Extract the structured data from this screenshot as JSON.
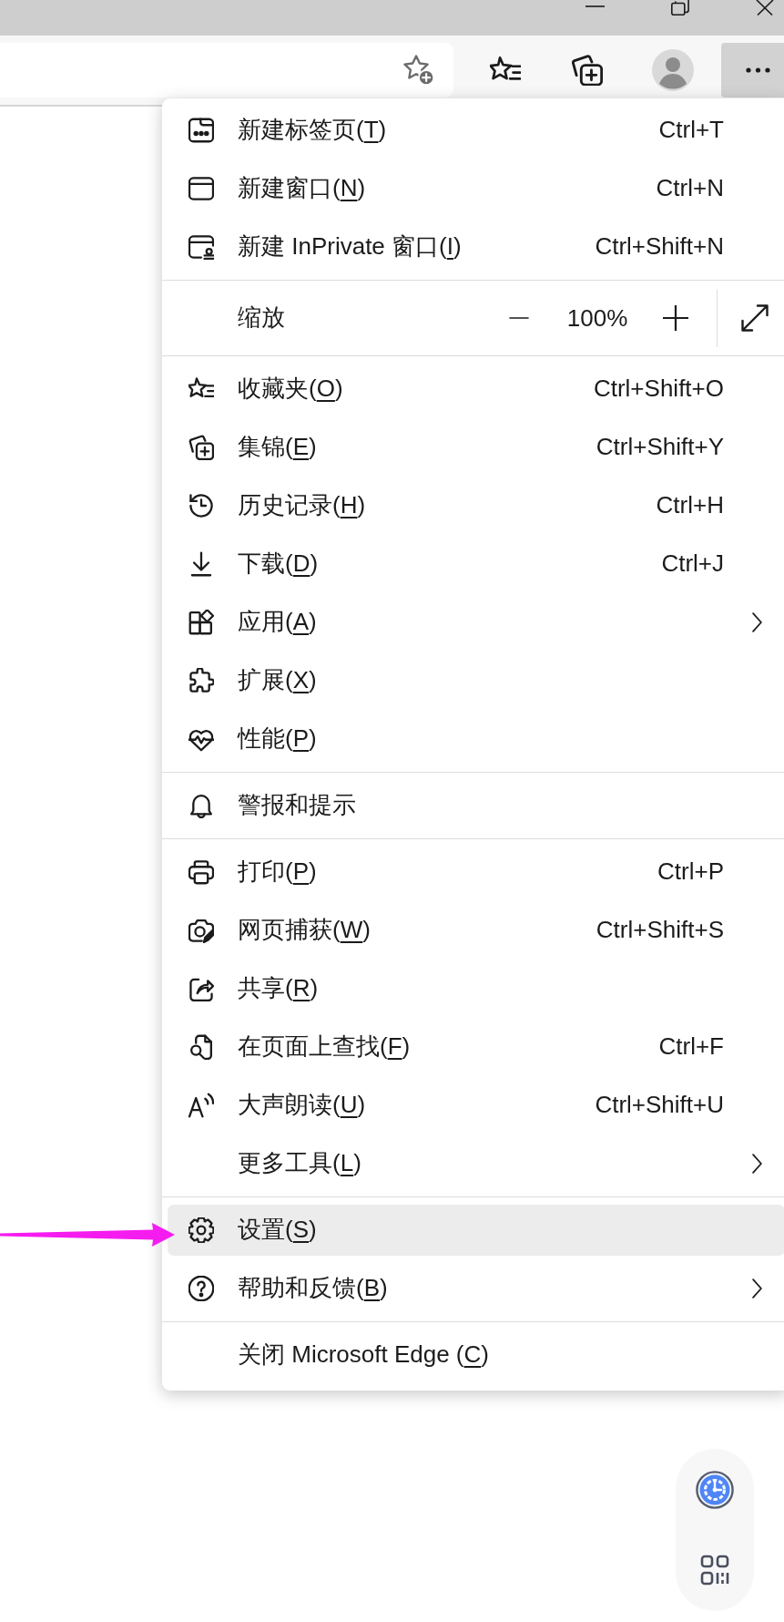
{
  "menu": {
    "sections": [
      {
        "items": [
          {
            "kind": "command",
            "label": "新建标签页(",
            "access_key": "T",
            "label_end": ")",
            "shortcut": "Ctrl+T",
            "submenu": false,
            "highlighted": false
          },
          {
            "kind": "command",
            "label": "新建窗口(",
            "access_key": "N",
            "label_end": ")",
            "shortcut": "Ctrl+N",
            "submenu": false,
            "highlighted": false
          },
          {
            "kind": "command",
            "label": "新建 InPrivate 窗口(",
            "access_key": "I",
            "label_end": ")",
            "shortcut": "Ctrl+Shift+N",
            "submenu": false,
            "highlighted": false
          }
        ]
      },
      {
        "items": [
          {
            "kind": "zoom",
            "label": "缩放",
            "value": "100%"
          }
        ]
      },
      {
        "items": [
          {
            "kind": "command",
            "label": "收藏夹(",
            "access_key": "O",
            "label_end": ")",
            "shortcut": "Ctrl+Shift+O",
            "submenu": false,
            "highlighted": false
          },
          {
            "kind": "command",
            "label": "集锦(",
            "access_key": "E",
            "label_end": ")",
            "shortcut": "Ctrl+Shift+Y",
            "submenu": false,
            "highlighted": false
          },
          {
            "kind": "command",
            "label": "历史记录(",
            "access_key": "H",
            "label_end": ")",
            "shortcut": "Ctrl+H",
            "submenu": false,
            "highlighted": false
          },
          {
            "kind": "command",
            "label": "下载(",
            "access_key": "D",
            "label_end": ")",
            "shortcut": "Ctrl+J",
            "submenu": false,
            "highlighted": false
          },
          {
            "kind": "command",
            "label": "应用(",
            "access_key": "A",
            "label_end": ")",
            "submenu": true,
            "highlighted": false
          },
          {
            "kind": "command",
            "label": "扩展(",
            "access_key": "X",
            "label_end": ")",
            "submenu": false,
            "highlighted": false
          },
          {
            "kind": "command",
            "label": "性能(",
            "access_key": "P",
            "label_end": ")",
            "submenu": false,
            "highlighted": false
          }
        ]
      },
      {
        "items": [
          {
            "kind": "command",
            "label": "警报和提示",
            "submenu": false,
            "highlighted": false
          }
        ]
      },
      {
        "items": [
          {
            "kind": "command",
            "label": "打印(",
            "access_key": "P",
            "label_end": ")",
            "shortcut": "Ctrl+P",
            "submenu": false,
            "highlighted": false
          },
          {
            "kind": "command",
            "label": "网页捕获(",
            "access_key": "W",
            "label_end": ")",
            "shortcut": "Ctrl+Shift+S",
            "submenu": false,
            "highlighted": false
          },
          {
            "kind": "command",
            "label": "共享(",
            "access_key": "R",
            "label_end": ")",
            "submenu": false,
            "highlighted": false
          },
          {
            "kind": "command",
            "label": "在页面上查找(",
            "access_key": "F",
            "label_end": ")",
            "shortcut": "Ctrl+F",
            "submenu": false,
            "highlighted": false
          },
          {
            "kind": "command",
            "label": "大声朗读(",
            "access_key": "U",
            "label_end": ")",
            "shortcut": "Ctrl+Shift+U",
            "submenu": false,
            "highlighted": false
          },
          {
            "kind": "command",
            "label": "更多工具(",
            "access_key": "L",
            "label_end": ")",
            "submenu": true,
            "highlighted": false
          }
        ]
      },
      {
        "items": [
          {
            "kind": "command",
            "label": "设置(",
            "access_key": "S",
            "label_end": ")",
            "submenu": false,
            "highlighted": true
          },
          {
            "kind": "command",
            "label": "帮助和反馈(",
            "access_key": "B",
            "label_end": ")",
            "submenu": true,
            "highlighted": false
          }
        ]
      },
      {
        "items": [
          {
            "kind": "command",
            "label": "关闭 Microsoft Edge (",
            "access_key": "C",
            "label_end": ")",
            "submenu": false,
            "highlighted": false
          }
        ]
      }
    ]
  },
  "annotation": {
    "kind": "arrow"
  }
}
